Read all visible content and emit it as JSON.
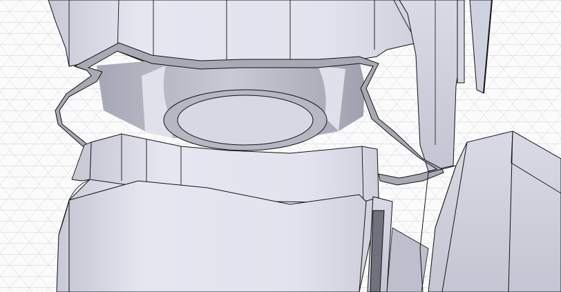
{
  "viewport": {
    "background_color": "#fbfbfc",
    "grid_color": "#9ea3ad",
    "model_fill_light": "#e2e3ee",
    "model_fill_mid": "#d3d4e0",
    "model_fill_dark": "#b7b8c4",
    "shadow_fill": "#a9abb7",
    "edge_color": "#111111"
  }
}
